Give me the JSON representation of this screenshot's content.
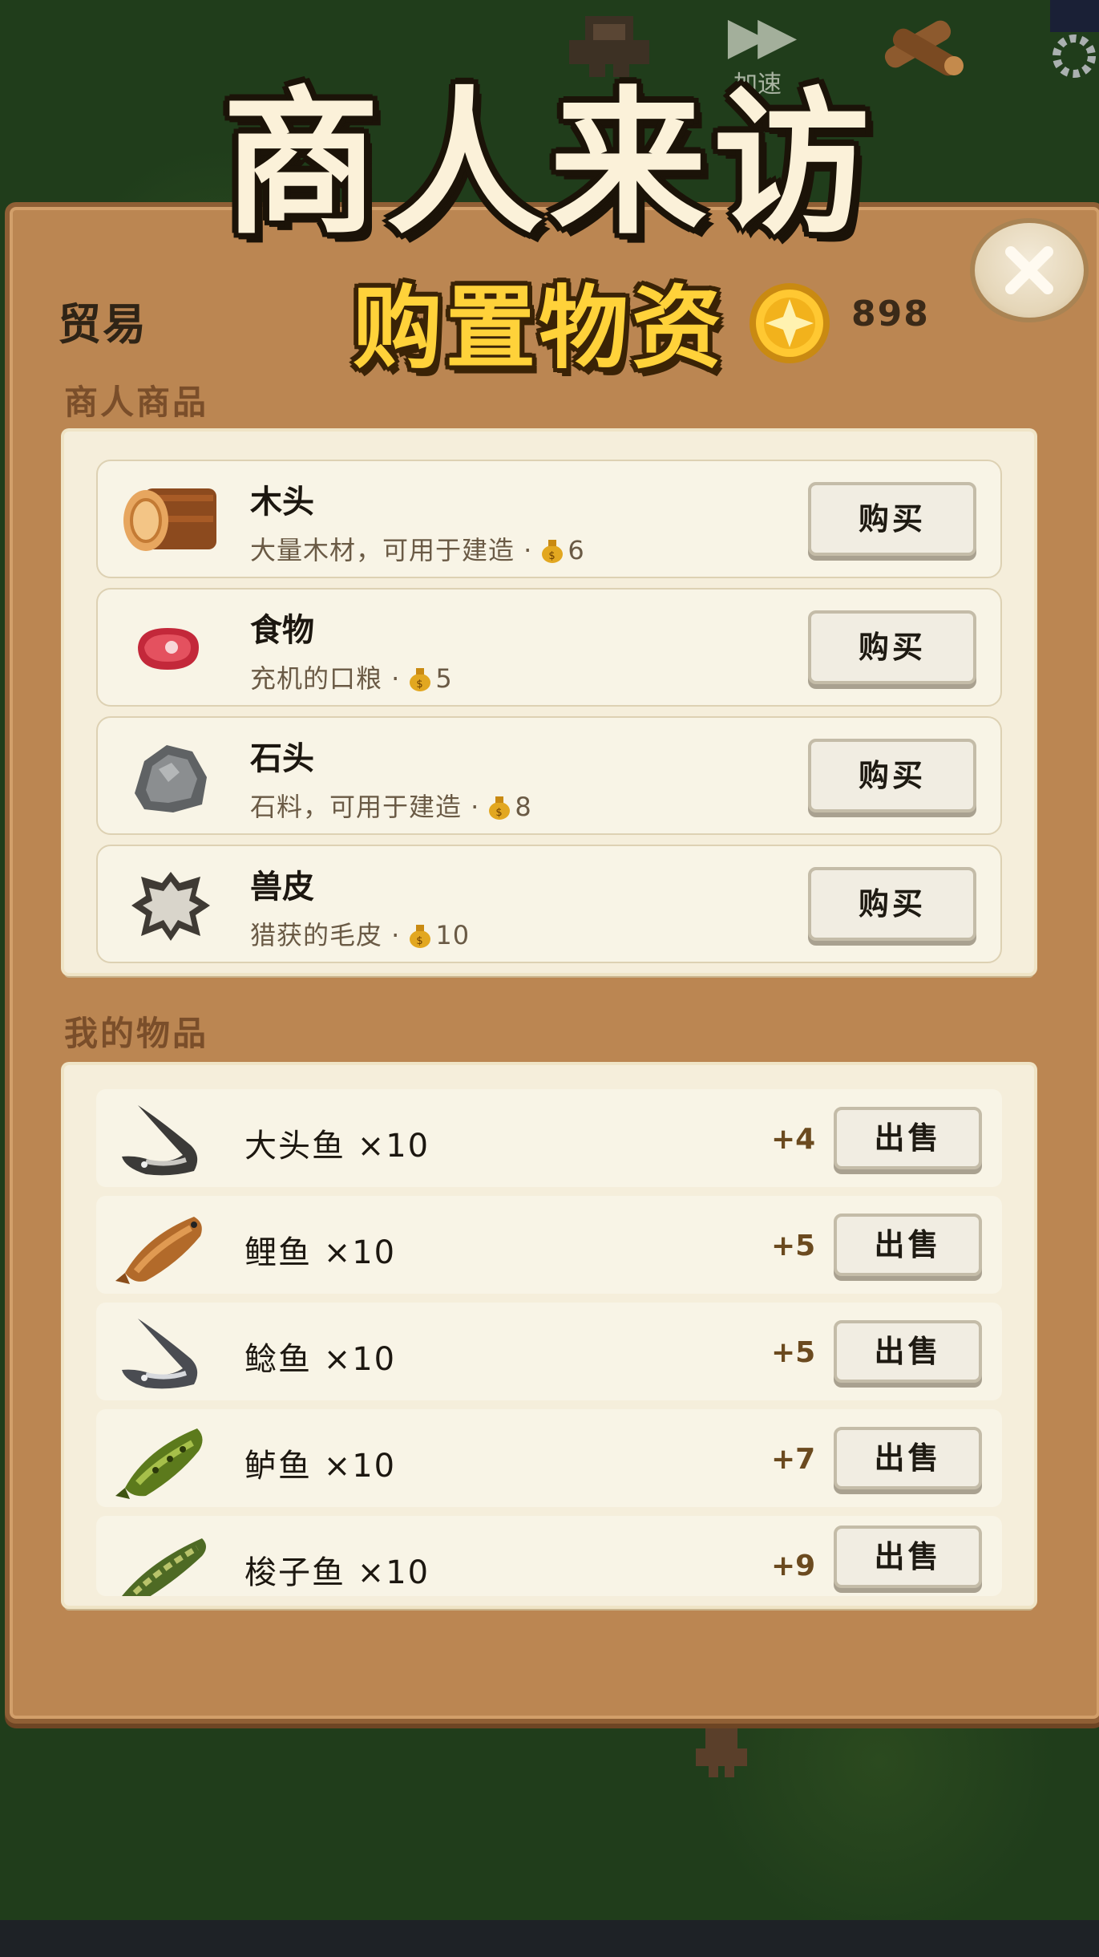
{
  "header": {
    "title": "商人来访",
    "subtitle": "购置物资",
    "coins": "898",
    "speed_label": "加速"
  },
  "dialog": {
    "tab_label": "贸易",
    "merchant_section": "商人商品",
    "inventory_section": "我的物品"
  },
  "merchant_items": [
    {
      "name": "木头",
      "desc": "大量木材，可用于建造 ·",
      "price": "6",
      "button": "购买",
      "icon": "log-icon"
    },
    {
      "name": "食物",
      "desc": "充机的口粮 ·",
      "price": "5",
      "button": "购买",
      "icon": "meat-icon"
    },
    {
      "name": "石头",
      "desc": "石料，可用于建造 ·",
      "price": "8",
      "button": "购买",
      "icon": "stone-icon"
    },
    {
      "name": "兽皮",
      "desc": "猎获的毛皮 ·",
      "price": "10",
      "button": "购买",
      "icon": "hide-icon"
    }
  ],
  "my_items": [
    {
      "name": "大头鱼 ×10",
      "price": "+4",
      "button": "出售",
      "icon": "catfish-icon"
    },
    {
      "name": "鲤鱼 ×10",
      "price": "+5",
      "button": "出售",
      "icon": "carp-icon"
    },
    {
      "name": "鲶鱼 ×10",
      "price": "+5",
      "button": "出售",
      "icon": "catfish-icon"
    },
    {
      "name": "鲈鱼 ×10",
      "price": "+7",
      "button": "出售",
      "icon": "bass-icon"
    },
    {
      "name": "梭子鱼 ×10",
      "price": "+9",
      "button": "出售",
      "icon": "pike-icon"
    }
  ],
  "colors": {
    "panel": "#bb8652",
    "card": "#f5eedb",
    "title": "#fbf1d9",
    "subtitle": "#ffd23a",
    "background": "#203d1b"
  }
}
